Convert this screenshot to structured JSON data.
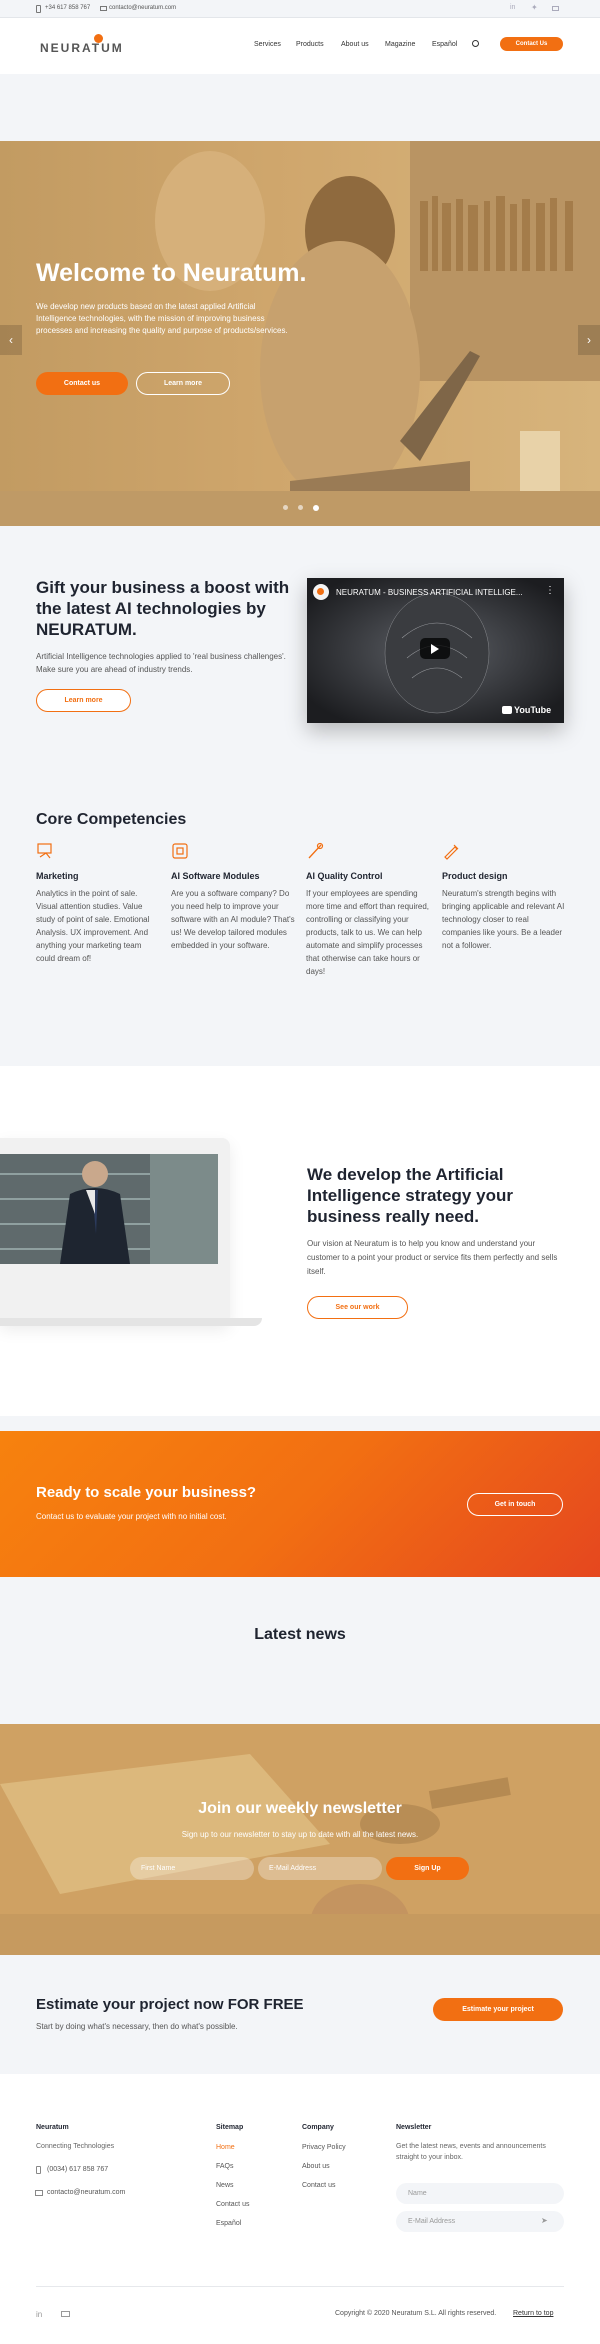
{
  "topbar": {
    "phone": "+34 617 858 767",
    "email": "contacto@neuratum.com",
    "social": [
      "linkedin-icon",
      "twitter-icon",
      "email-icon"
    ]
  },
  "header": {
    "logo": "NEURATUM",
    "nav": [
      "Services",
      "Products",
      "About us",
      "Magazine",
      "Español"
    ],
    "cta": "Contact Us"
  },
  "hero": {
    "title": "Welcome to Neuratum.",
    "text": "We develop new products based on the latest applied Artificial Intelligence technologies, with the mission of improving business processes and increasing the quality and purpose of products/services.",
    "btn1": "Contact us",
    "btn2": "Learn more",
    "slides": 3,
    "active_slide": 3
  },
  "boost": {
    "title": "Gift your business a boost with the latest AI technologies by NEURATUM.",
    "text": "Artificial Intelligence technologies applied to 'real business challenges'. Make sure you are ahead of industry trends.",
    "btn": "Learn more",
    "video_title": "NEURATUM - BUSINESS ARTIFICIAL INTELLIGE...",
    "video_brand": "YouTube"
  },
  "competencies": {
    "title": "Core Competencies",
    "items": [
      {
        "icon": "marketing-icon",
        "title": "Marketing",
        "text": "Analytics in the point of sale. Visual attention studies. Value study of point of sale. Emotional Analysis. UX improvement. And anything your marketing team could dream of!"
      },
      {
        "icon": "software-icon",
        "title": "AI Software Modules",
        "text": "Are you a software company? Do you need help to improve your software with an AI module? That's us! We develop tailored modules embedded in your software."
      },
      {
        "icon": "quality-icon",
        "title": "AI Quality Control",
        "text": "If your employees are spending more time and effort than required, controlling or classifying your products, talk to us. We can help automate and simplify processes that otherwise can take hours or days!"
      },
      {
        "icon": "design-icon",
        "title": "Product design",
        "text": "Neuratum's strength begins with bringing applicable and relevant AI technology closer to real companies like yours. Be a leader not a follower."
      }
    ]
  },
  "strategy": {
    "title": "We develop the Artificial Intelligence strategy your business really need.",
    "text": "Our vision at Neuratum is to help you know and understand your customer to a point your product or service fits them perfectly and sells itself.",
    "btn": "See our work"
  },
  "scale": {
    "title": "Ready to scale your business?",
    "text": "Contact us to evaluate your project with no initial cost.",
    "btn": "Get in touch"
  },
  "news": {
    "title": "Latest news"
  },
  "newsletter": {
    "title": "Join our weekly newsletter",
    "text": "Sign up to our newsletter to stay up to date with all the latest news.",
    "first_name": "First Name",
    "email": "E-Mail Address",
    "btn": "Sign Up"
  },
  "estimate": {
    "title": "Estimate your project now FOR FREE",
    "text": "Start by doing what's necessary, then do what's possible.",
    "btn": "Estimate your project"
  },
  "footer": {
    "company_name": "Neuratum",
    "tagline": "Connecting Technologies",
    "phone": "(0034) 617 858 767",
    "email": "contacto@neuratum.com",
    "sitemap_title": "Sitemap",
    "sitemap": [
      "Home",
      "FAQs",
      "News",
      "Contact us",
      "Español"
    ],
    "company_title": "Company",
    "company": [
      "Privacy Policy",
      "About us",
      "Contact us"
    ],
    "newsletter_title": "Newsletter",
    "newsletter_text": "Get the latest news, events and announcements straight to your inbox.",
    "name_ph": "Name",
    "email_ph": "E-Mail Address",
    "copyright": "Copyright © 2020 Neuratum S.L. All rights reserved.",
    "return": "Return to top"
  },
  "colors": {
    "accent": "#f26f12",
    "dark": "#2b2f3a"
  }
}
